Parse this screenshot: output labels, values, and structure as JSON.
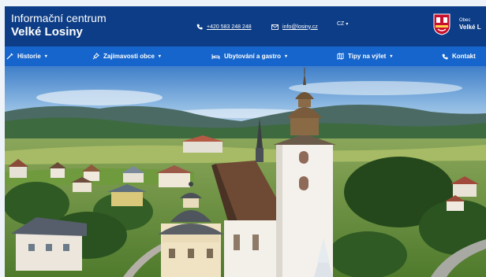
{
  "header": {
    "title_line1": "Informační centrum",
    "title_line2": "Velké Losiny",
    "phone": "+420 583 248 248",
    "email": "info@losiny.cz",
    "language": "CZ",
    "municipality_label": "Obec",
    "municipality_name": "Velké L"
  },
  "nav": {
    "items": [
      {
        "label": "Historie",
        "icon": "history-icon"
      },
      {
        "label": "Zajímavosti obce",
        "icon": "pin-icon"
      },
      {
        "label": "Ubytování a gastro",
        "icon": "bed-icon"
      },
      {
        "label": "Tipy na výlet",
        "icon": "map-icon"
      },
      {
        "label": "Kontakt",
        "icon": "phone-icon"
      }
    ]
  },
  "colors": {
    "header_bg": "#0d3d86",
    "nav_bg": "#1565cc",
    "text": "#ffffff"
  }
}
